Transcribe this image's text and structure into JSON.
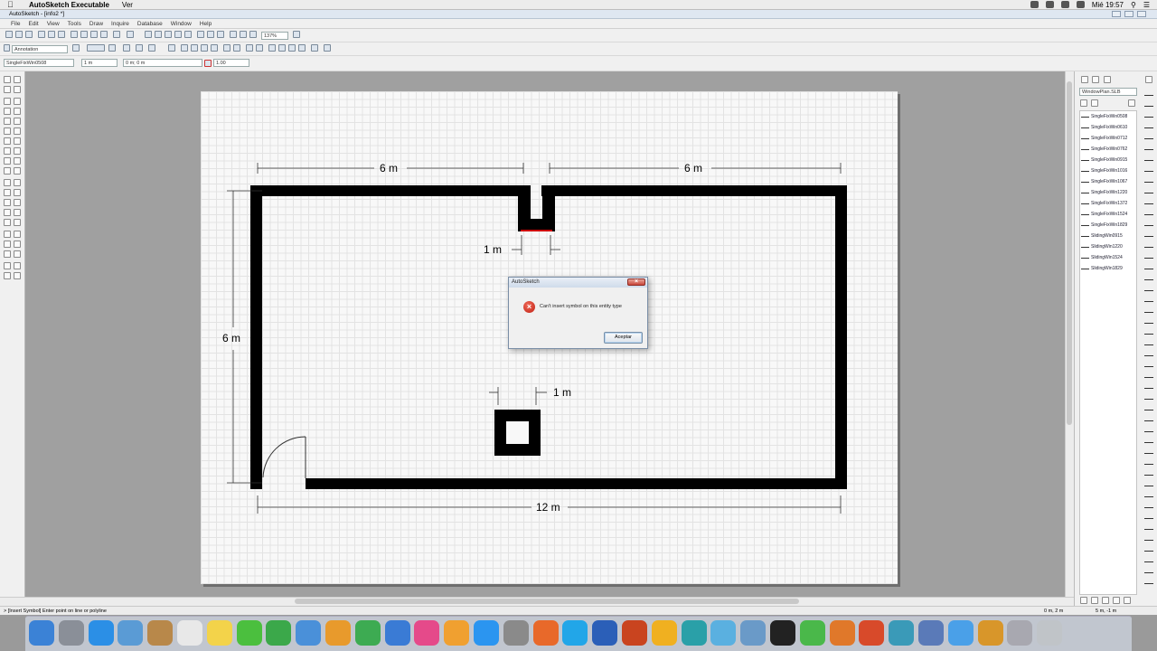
{
  "mac_menubar": {
    "app_name": "AutoSketch Executable",
    "menu_ver": "Ver",
    "clock": "Mié 19:57"
  },
  "window": {
    "title": "AutoSketch - [info2 *]"
  },
  "menu": [
    "File",
    "Edit",
    "View",
    "Tools",
    "Draw",
    "Inquire",
    "Database",
    "Window",
    "Help"
  ],
  "toolbar": {
    "zoom": "137%",
    "layer": "Annotation",
    "entity_name": "SingleFixWin0508",
    "width_value": "1 m",
    "angle_value": "0 m; 0 m",
    "scale_value": "1.00"
  },
  "drawing": {
    "dim_top_left": "6 m",
    "dim_top_right": "6 m",
    "dim_window_gap": "1 m",
    "dim_left_height": "6 m",
    "dim_column": "1 m",
    "dim_bottom": "12 m"
  },
  "dialog": {
    "title": "AutoSketch",
    "message": "Can't insert symbol on this entity type",
    "ok_label": "Aceptar"
  },
  "symbol_panel": {
    "library": "WindowPlan.SLB",
    "items": [
      "SingleFixWin0508",
      "SingleFixWin0610",
      "SingleFixWin0712",
      "SingleFixWin0762",
      "SingleFixWin0915",
      "SingleFixWin1016",
      "SingleFixWin1067",
      "SingleFixWin1220",
      "SingleFixWin1372",
      "SingleFixWin1524",
      "SingleFixWin1829",
      "SlidingWin0915",
      "SlidingWin1220",
      "SlidingWin1524",
      "SlidingWin1829"
    ]
  },
  "status": {
    "prompt": "> [Insert Symbol] Enter point on line or polyline",
    "coord1": "0 m, 2 m",
    "coord2": "5 m, -1 m"
  },
  "dock_icons": [
    "finder-icon",
    "launchpad-icon",
    "safari-icon",
    "preview-icon",
    "contacts-icon",
    "calendar-icon",
    "notes-icon",
    "messages-icon",
    "facetime-icon",
    "mail-icon",
    "pages-icon",
    "numbers-icon",
    "keynote-icon",
    "itunes-icon",
    "ibooks-icon",
    "appstore-icon",
    "system-preferences-icon",
    "firefox-icon",
    "skype-icon",
    "word-icon",
    "powerpoint-icon",
    "outlook-icon",
    "chrome-icon",
    "utility-icon",
    "archive-icon",
    "terminal-icon",
    "recycle-icon",
    "sublime-icon",
    "office-icon",
    "autosketch-icon",
    "photos-icon",
    "folder-icon",
    "box-icon",
    "downloads-icon",
    "trash-icon"
  ]
}
